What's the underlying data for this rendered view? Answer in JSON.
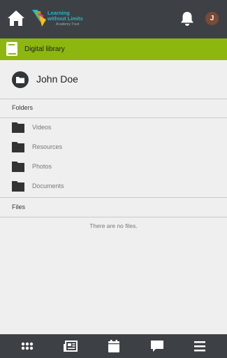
{
  "header": {
    "logo_line1": "Learning",
    "logo_line2": "without Limits",
    "logo_line3": "Academy Trust",
    "avatar_initial": "J"
  },
  "section_bar": {
    "title": "Digital library"
  },
  "user": {
    "name": "John Doe"
  },
  "folders_section": {
    "title": "Folders",
    "items": [
      {
        "label": "Videos"
      },
      {
        "label": "Resources"
      },
      {
        "label": "Photos"
      },
      {
        "label": "Documents"
      }
    ]
  },
  "files_section": {
    "title": "Files",
    "empty_text": "There are no files."
  },
  "colors": {
    "topbar": "#3d4145",
    "accent_green": "#8db70f",
    "background": "#efefef"
  },
  "bottom_nav": {
    "icons": [
      "apps-grid-icon",
      "newspaper-icon",
      "calendar-icon",
      "chat-icon",
      "menu-icon"
    ]
  }
}
